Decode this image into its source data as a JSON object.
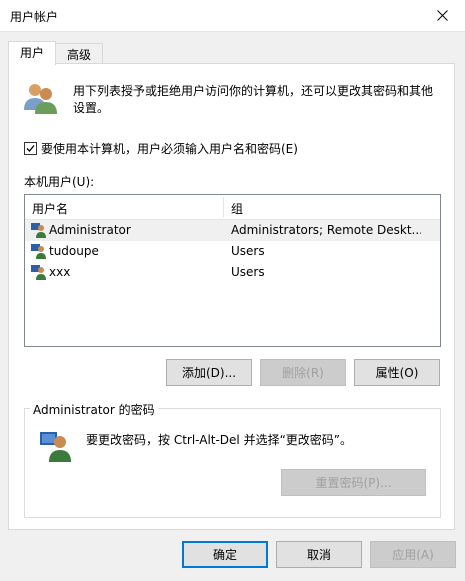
{
  "window": {
    "title": "用户帐户"
  },
  "tabs": [
    {
      "label": "用户"
    },
    {
      "label": "高级"
    }
  ],
  "description": "用下列表授予或拒绝用户访问你的计算机，还可以更改其密码和其他设置。",
  "require_password": {
    "label": "要使用本计算机，用户必须输入用户名和密码(E)",
    "checked": true
  },
  "local_users": {
    "label": "本机用户(U):",
    "columns": [
      "用户名",
      "组"
    ],
    "rows": [
      {
        "name": "Administrator",
        "group": "Administrators; Remote Deskt...",
        "selected": true
      },
      {
        "name": "tudoupe",
        "group": "Users",
        "selected": false
      },
      {
        "name": "xxx",
        "group": "Users",
        "selected": false
      }
    ]
  },
  "user_buttons": {
    "add": "添加(D)...",
    "remove": "删除(R)",
    "properties": "属性(O)"
  },
  "password_section": {
    "title": "Administrator 的密码",
    "text": "要更改密码，按 Ctrl-Alt-Del 并选择“更改密码”。",
    "reset_button": "重置密码(P)..."
  },
  "dialog_buttons": {
    "ok": "确定",
    "cancel": "取消",
    "apply": "应用(A)"
  },
  "colors": {
    "accent": "#0078d7",
    "disabled_text": "#a0a0a0"
  },
  "icons": {
    "users": "users-icon",
    "user": "user-icon",
    "close": "close-icon",
    "check": "checkmark-icon"
  }
}
